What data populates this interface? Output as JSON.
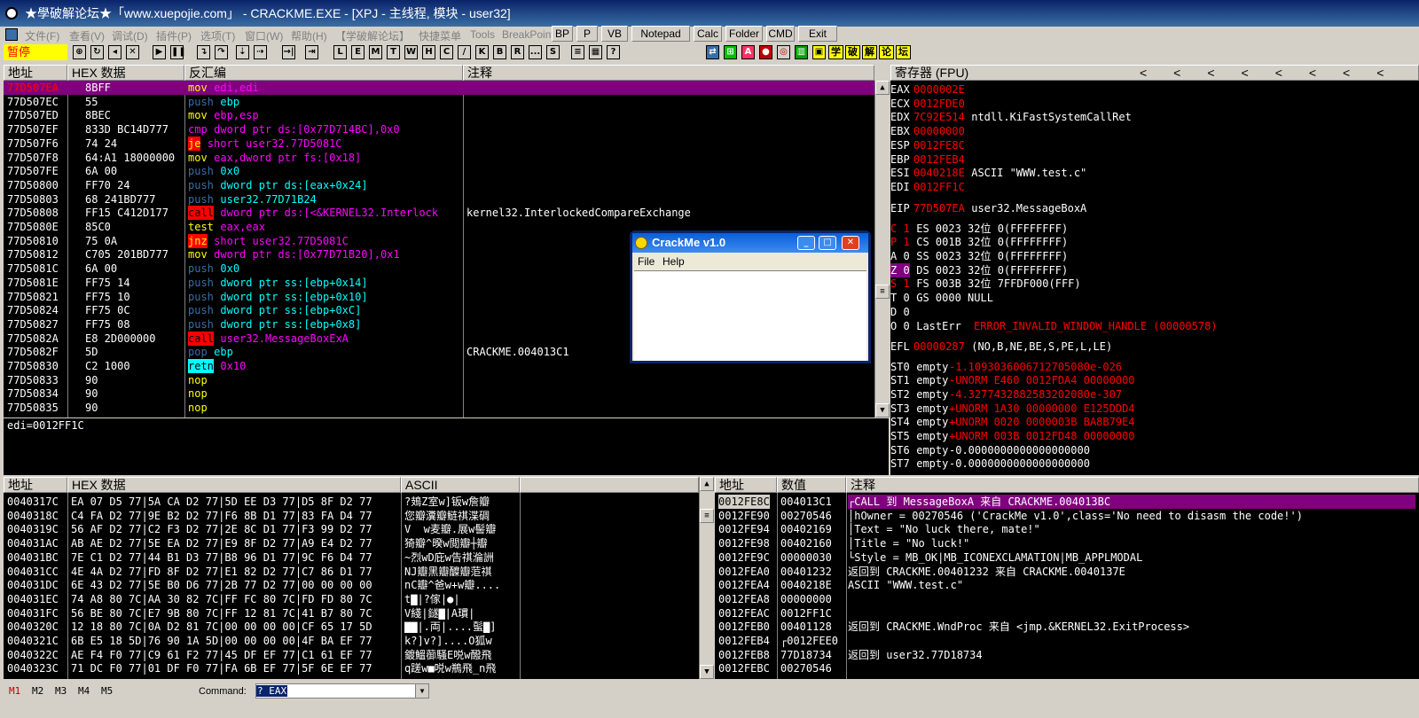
{
  "window": {
    "title": "★學破解论坛★「www.xuepojie.com」 - CRACKME.EXE - [XPJ - 主线程, 模块 - user32]"
  },
  "menu": [
    "文件(F)",
    "查看(V)",
    "调试(D)",
    "插件(P)",
    "选项(T)",
    "窗口(W)",
    "帮助(H)",
    "【学破解论坛】",
    "快捷菜单",
    "Tools",
    "BreakPoint"
  ],
  "shortcuts": [
    "BP",
    "P",
    "VB",
    "Notepad",
    "Calc",
    "Folder",
    "CMD",
    "Exit"
  ],
  "toolbar": {
    "status": "暂停",
    "letters": [
      "L",
      "E",
      "M",
      "T",
      "W",
      "H",
      "C",
      "/",
      "K",
      "B",
      "R",
      "...",
      "S"
    ],
    "cn_buttons": [
      "学",
      "破",
      "解",
      "论",
      "坛"
    ]
  },
  "cpu": {
    "headers": {
      "addr": "地址",
      "hex": "HEX 数据",
      "disasm": "反汇编",
      "comment": "注释"
    },
    "rows": [
      {
        "addr": "77D507EA",
        "hex": "8BFF",
        "mnem": "mov",
        "ops": " edi,edi",
        "comment": ""
      },
      {
        "addr": "77D507EC",
        "hex": "55",
        "mnem": "push",
        "ops": " ebp",
        "comment": ""
      },
      {
        "addr": "77D507ED",
        "hex": "8BEC",
        "mnem": "mov",
        "ops": " ebp,esp",
        "comment": ""
      },
      {
        "addr": "77D507EF",
        "hex": "833D BC14D777",
        "mnem": "cmp",
        "ops": " dword ptr ds:[0x77D714BC],0x0",
        "comment": ""
      },
      {
        "addr": "77D507F6",
        "hex": "74 24",
        "mnem": "je",
        "ops": " short user32.77D5081C",
        "comment": ""
      },
      {
        "addr": "77D507F8",
        "hex": "64:A1 18000000",
        "mnem": "mov",
        "ops": " eax,dword ptr fs:[0x18]",
        "comment": ""
      },
      {
        "addr": "77D507FE",
        "hex": "6A 00",
        "mnem": "push",
        "ops": " 0x0",
        "comment": ""
      },
      {
        "addr": "77D50800",
        "hex": "FF70 24",
        "mnem": "push",
        "ops": " dword ptr ds:[eax+0x24]",
        "comment": ""
      },
      {
        "addr": "77D50803",
        "hex": "68 241BD777",
        "mnem": "push",
        "ops": " user32.77D71B24",
        "comment": ""
      },
      {
        "addr": "77D50808",
        "hex": "FF15 C412D177",
        "mnem": "call",
        "ops": " dword ptr ds:[<&KERNEL32.Interlock",
        "comment": "kernel32.InterlockedCompareExchange"
      },
      {
        "addr": "77D5080E",
        "hex": "85C0",
        "mnem": "test",
        "ops": " eax,eax",
        "comment": ""
      },
      {
        "addr": "77D50810",
        "hex": "75 0A",
        "mnem": "jnz",
        "ops": " short user32.77D5081C",
        "comment": ""
      },
      {
        "addr": "77D50812",
        "hex": "C705 201BD777",
        "mnem": "mov",
        "ops": " dword ptr ds:[0x77D71B20],0x1",
        "comment": ""
      },
      {
        "addr": "77D5081C",
        "hex": "6A 00",
        "mnem": "push",
        "ops": " 0x0",
        "comment": ""
      },
      {
        "addr": "77D5081E",
        "hex": "FF75 14",
        "mnem": "push",
        "ops": " dword ptr ss:[ebp+0x14]",
        "comment": ""
      },
      {
        "addr": "77D50821",
        "hex": "FF75 10",
        "mnem": "push",
        "ops": " dword ptr ss:[ebp+0x10]",
        "comment": ""
      },
      {
        "addr": "77D50824",
        "hex": "FF75 0C",
        "mnem": "push",
        "ops": " dword ptr ss:[ebp+0xC]",
        "comment": ""
      },
      {
        "addr": "77D50827",
        "hex": "FF75 08",
        "mnem": "push",
        "ops": " dword ptr ss:[ebp+0x8]",
        "comment": ""
      },
      {
        "addr": "77D5082A",
        "hex": "E8 2D000000",
        "mnem": "call",
        "ops": " user32.MessageBoxExA",
        "comment": ""
      },
      {
        "addr": "77D5082F",
        "hex": "5D",
        "mnem": "pop",
        "ops": " ebp",
        "comment": "CRACKME.004013C1"
      },
      {
        "addr": "77D50830",
        "hex": "C2 1000",
        "mnem": "retn",
        "ops": " 0x10",
        "comment": ""
      },
      {
        "addr": "77D50833",
        "hex": "90",
        "mnem": "nop",
        "ops": "",
        "comment": ""
      },
      {
        "addr": "77D50834",
        "hex": "90",
        "mnem": "nop",
        "ops": "",
        "comment": ""
      },
      {
        "addr": "77D50835",
        "hex": "90",
        "mnem": "nop",
        "ops": "",
        "comment": ""
      }
    ],
    "info": "edi=0012FF1C"
  },
  "registers": {
    "header": "寄存器 (FPU)",
    "lines": [
      {
        "name": "EAX",
        "val": "0000002E",
        "extra": ""
      },
      {
        "name": "ECX",
        "val": "0012FDE0",
        "extra": ""
      },
      {
        "name": "EDX",
        "val": "7C92E514",
        "extra": " ntdll.KiFastSystemCallRet"
      },
      {
        "name": "EBX",
        "val": "00000000",
        "extra": ""
      },
      {
        "name": "ESP",
        "val": "0012FE8C",
        "extra": ""
      },
      {
        "name": "EBP",
        "val": "0012FEB4",
        "extra": ""
      },
      {
        "name": "ESI",
        "val": "0040218E",
        "extra": " ASCII \"WWW.test.c\""
      },
      {
        "name": "EDI",
        "val": "0012FF1C",
        "extra": ""
      }
    ],
    "eip": {
      "name": "EIP",
      "val": "77D507EA",
      "extra": " user32.MessageBoxA"
    },
    "segs": [
      {
        "flag": "C 1",
        "text": " ES 0023 32位 0(FFFFFFFF)"
      },
      {
        "flag": "P 1",
        "text": " CS 001B 32位 0(FFFFFFFF)"
      },
      {
        "flag": "A 0",
        "text": " SS 0023 32位 0(FFFFFFFF)"
      },
      {
        "flag": "Z 0",
        "text": " DS 0023 32位 0(FFFFFFFF)"
      },
      {
        "flag": "S 1",
        "text": " FS 003B 32位 7FFDF000(FFF)"
      },
      {
        "flag": "T 0",
        "text": " GS 0000 NULL"
      },
      {
        "flag": "D 0",
        "text": ""
      }
    ],
    "lasterr": {
      "flag": "O 0",
      "label": " LastErr ",
      "val": "ERROR_INVALID_WINDOW_HANDLE (00000578)"
    },
    "efl": {
      "name": "EFL",
      "val": "00000287",
      "extra": " (NO,B,NE,BE,S,PE,L,LE)"
    },
    "fpu": [
      {
        "name": "ST0",
        "tag": " empty ",
        "val": "-1.1093036006712705080e-026"
      },
      {
        "name": "ST1",
        "tag": " empty ",
        "val": "-UNORM E460 0012FDA4 00000000"
      },
      {
        "name": "ST2",
        "tag": " empty ",
        "val": "-4.3277432882583202080e-307"
      },
      {
        "name": "ST3",
        "tag": " empty ",
        "val": "+UNORM 1A30 00000000 E125DDD4"
      },
      {
        "name": "ST4",
        "tag": " empty ",
        "val": "+UNORM 0020 0000003B BA8B79E4"
      },
      {
        "name": "ST5",
        "tag": " empty ",
        "val": "+UNORM 003B 0012FD48 00000000"
      },
      {
        "name": "ST6",
        "tag": " empty ",
        "val": "-0.0000000000000000000"
      },
      {
        "name": "ST7",
        "tag": " empty ",
        "val": "-0.0000000000000000000"
      }
    ]
  },
  "dump": {
    "headers": {
      "addr": "地址",
      "hex": "HEX 数据",
      "ascii": "ASCII"
    },
    "rows": [
      {
        "addr": "0040317C",
        "hex": "EA 07 D5 77|5A CA D2 77|5D EE D3 77|D5 8F D2 77",
        "ascii": "?鳷Z室w]钣w詹瓣"
      },
      {
        "addr": "0040318C",
        "hex": "C4 FA D2 77|9E B2 D2 77|F6 8B D1 77|83 FA D4 77",
        "ascii": "您瓣瀵瓣鲢祺渫碉"
      },
      {
        "addr": "0040319C",
        "hex": "56 AF D2 77|C2 F3 D2 77|2E 8C D1 77|F3 99 D2 77",
        "ascii": "V  w麦瓣.展w髻瓣"
      },
      {
        "addr": "004031AC",
        "hex": "AB AE D2 77|5E EA D2 77|E9 8F D2 77|A9 E4 D2 77",
        "ascii": "猗瓣^暌w閲瓣┼瓣"
      },
      {
        "addr": "004031BC",
        "hex": "7E C1 D2 77|44 B1 D3 77|B8 96 D1 77|9C F6 D4 77",
        "ascii": "~烈wD庇w告祺溣詶"
      },
      {
        "addr": "004031CC",
        "hex": "4E 4A D2 77|FD 8F D2 77|E1 82 D2 77|C7 86 D1 77",
        "ascii": "NJ瓣黑瓣醾瓣菃祺"
      },
      {
        "addr": "004031DC",
        "hex": "6E 43 D2 77|5E B0 D6 77|2B 77 D2 77|00 00 00 00",
        "ascii": "nC瓣^爸w+w瓣...."
      },
      {
        "addr": "004031EC",
        "hex": "74 A8 80 7C|AA 30 82 7C|FF FC 80 7C|FD FD 80 7C",
        "ascii": "t▇|?傢|●|"
      },
      {
        "addr": "004031FC",
        "hex": "56 BE 80 7C|E7 9B 80 7C|FF 12 81 7C|41 B7 80 7C",
        "ascii": "V綫|鐩▇|A瑻|"
      },
      {
        "addr": "0040320C",
        "hex": "12 18 80 7C|0A D2 81 7C|00 00 00 00|CF 65 17 5D",
        "ascii": "▇▇|.両|....蟚▇]"
      },
      {
        "addr": "0040321C",
        "hex": "6B E5 18 5D|76 90 1A 5D|00 00 00 00|4F BA EF 77",
        "ascii": "k?]v?]....O狐w"
      },
      {
        "addr": "0040322C",
        "hex": "AE F4 F0 77|C9 61 F2 77|45 DF EF 77|C1 61 EF 77",
        "ascii": "鍍鰮蓹騒E哾w醱飛"
      },
      {
        "addr": "0040323C",
        "hex": "71 DC F0 77|01 DF F0 77|FA 6B EF 77|5F 6E EF 77",
        "ascii": "q蹉w■哾w鵧飛_n飛"
      }
    ]
  },
  "stack": {
    "headers": {
      "addr": "地址",
      "val": "数值",
      "comment": "注释"
    },
    "rows": [
      {
        "addr": "0012FE8C",
        "val": "004013C1",
        "comment": "┌CALL 到 MessageBoxA 来自 CRACKME.004013BC"
      },
      {
        "addr": "0012FE90",
        "val": "00270546",
        "comment": "│hOwner = 00270546 ('CrackMe v1.0',class='No need to disasm the code!')"
      },
      {
        "addr": "0012FE94",
        "val": "00402169",
        "comment": "│Text = \"No luck there, mate!\""
      },
      {
        "addr": "0012FE98",
        "val": "00402160",
        "comment": "│Title = \"No luck!\""
      },
      {
        "addr": "0012FE9C",
        "val": "00000030",
        "comment": "└Style = MB_OK|MB_ICONEXCLAMATION|MB_APPLMODAL"
      },
      {
        "addr": "0012FEA0",
        "val": "00401232",
        "comment": "返回到 CRACKME.00401232 来自 CRACKME.0040137E"
      },
      {
        "addr": "0012FEA4",
        "val": "0040218E",
        "comment": "ASCII \"WWW.test.c\""
      },
      {
        "addr": "0012FEA8",
        "val": "00000000",
        "comment": ""
      },
      {
        "addr": "0012FEAC",
        "val": "0012FF1C",
        "comment": ""
      },
      {
        "addr": "0012FEB0",
        "val": "00401128",
        "comment": "返回到 CRACKME.WndProc 来自 <jmp.&KERNEL32.ExitProcess>"
      },
      {
        "addr": "0012FEB4",
        "val": "┌0012FEE0",
        "comment": ""
      },
      {
        "addr": "0012FEB8",
        "val": "77D18734",
        "comment": "返回到 user32.77D18734"
      },
      {
        "addr": "0012FEBC",
        "val": "00270546",
        "comment": ""
      }
    ]
  },
  "crackme": {
    "title": "CrackMe v1.0",
    "menu": [
      "File",
      "Help"
    ]
  },
  "command": {
    "label": "Command:",
    "value": "? EAX",
    "tabs": [
      "M1",
      "M2",
      "M3",
      "M4",
      "M5"
    ]
  },
  "colors": {
    "highlight": "#800080",
    "red": "#ff0000",
    "cyan": "#00ffff",
    "blue": "#3a6ea5"
  }
}
